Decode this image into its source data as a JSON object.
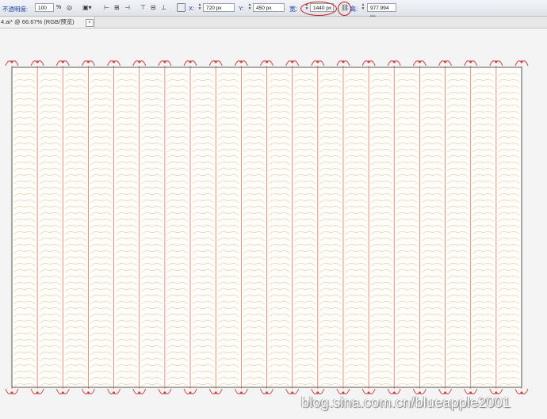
{
  "toolbar": {
    "opacity_label": "不透明度:",
    "opacity_value": "100",
    "opacity_unit": "%",
    "x_label": "X:",
    "x_value": "720 px",
    "y_label": "Y:",
    "y_value": "450 px",
    "width_label": "宽:",
    "width_value": "1440 px",
    "height_label": "高:",
    "height_value": "977.994 px"
  },
  "document_tab": {
    "title": "4.ai* @ 66.67% (RGB/预览)",
    "close_glyph": "×"
  },
  "artwork": {
    "columns": 20,
    "stripe_color": "#e0785a",
    "leaf_color": "#e9c9a8",
    "border_color": "#555555"
  },
  "watermark": "blog.sina.com.cn/blueapple2001"
}
